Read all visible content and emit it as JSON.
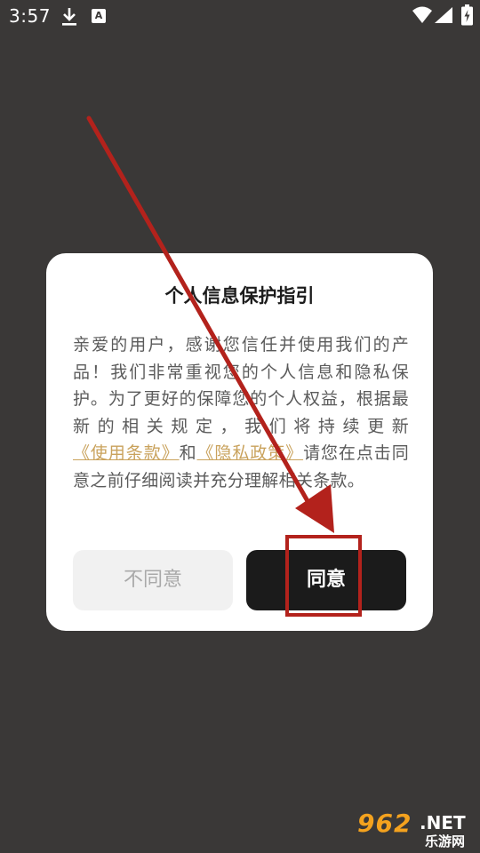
{
  "status_bar": {
    "time": "3:57",
    "icons": [
      "download-icon",
      "a-notification-icon",
      "wifi-icon",
      "signal-icon",
      "battery-charging-icon"
    ],
    "a_glyph": "A"
  },
  "dialog": {
    "title": "个人信息保护指引",
    "body_part1": "亲爱的用户，感谢您信任并使用我们的产品！我们非常重视您的个人信息和隐私保护。为了更好的保障您的个人权益，根据最新的相关规定，我们将持续更新",
    "link_terms": "《使用条款》",
    "conjunction": "和",
    "link_privacy": "《隐私政策》",
    "body_part2": "请您在点击同意之前仔细阅读并充分理解相关条款。",
    "disagree_label": "不同意",
    "agree_label": "同意"
  },
  "watermark": {
    "main": "962",
    "net": ".NET",
    "sub": "乐游网"
  },
  "colors": {
    "backdrop": "#3a3837",
    "link": "#c9a25c",
    "agree_bg": "#1b1b1b",
    "disagree_bg": "#f1f1f1",
    "annotation": "#b3221c"
  }
}
